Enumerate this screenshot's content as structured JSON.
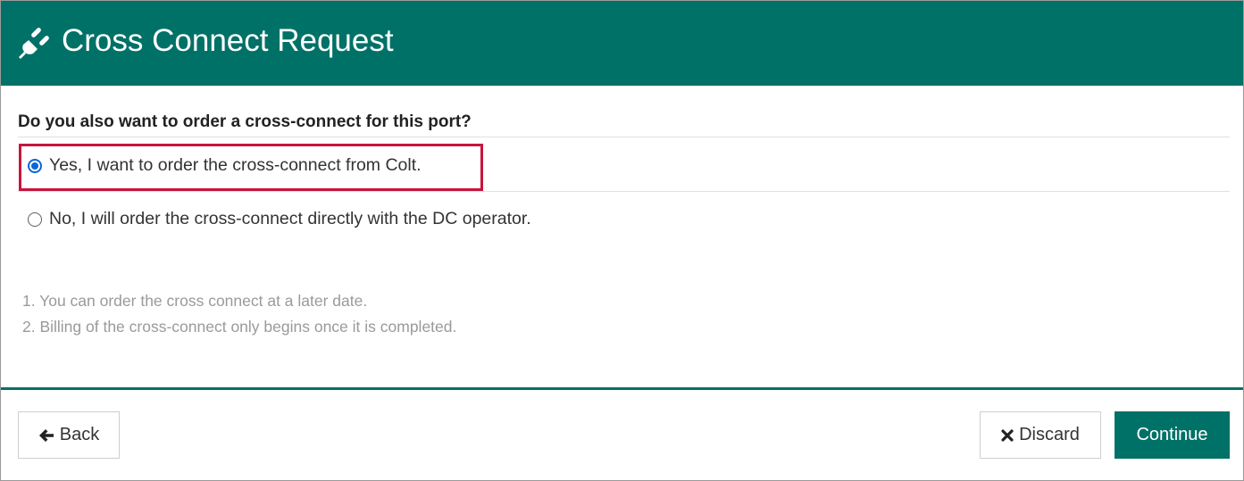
{
  "header": {
    "icon": "plug-icon",
    "title": "Cross Connect Request",
    "background_color": "#007167"
  },
  "form": {
    "question": "Do you also want to order a cross-connect for this port?",
    "options": [
      {
        "label": "Yes, I want to order the cross-connect from Colt.",
        "selected": true
      },
      {
        "label": "No, I will order the cross-connect directly with the DC operator.",
        "selected": false
      }
    ],
    "highlight_color": "#c8143c"
  },
  "notes": [
    "1. You can order the cross connect at a later date.",
    "2. Billing of the cross-connect only begins once it is completed."
  ],
  "footer": {
    "back_label": "Back",
    "back_icon": "arrow-left-icon",
    "discard_label": "Discard",
    "discard_icon": "close-icon",
    "continue_label": "Continue",
    "accent_color": "#007167"
  }
}
